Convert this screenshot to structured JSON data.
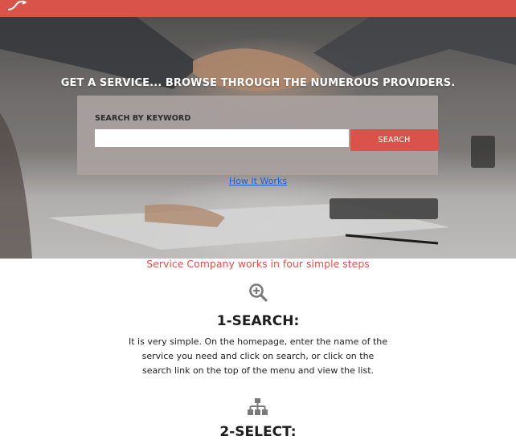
{
  "header": {
    "logo_icon": "logo-icon",
    "brand_color": "#d9534a"
  },
  "hero": {
    "heading": "GET A SERVICE... BROWSE THROUGH THE NUMEROUS PROVIDERS.",
    "search_label": "SEARCH BY KEYWORD",
    "search_value": "",
    "search_placeholder": "",
    "search_button": "SEARCH",
    "how_it_works_link": "How It Works"
  },
  "steps": {
    "intro": "Service Company works in four simple steps",
    "items": [
      {
        "icon": "search-plus-icon",
        "title": "1-SEARCH:",
        "text": "It is very simple. On the homepage, enter the name of the service you need and click on search, or click on the search link on the top of the menu and view the list."
      },
      {
        "icon": "sitemap-icon",
        "title": "2-SELECT:"
      }
    ]
  },
  "colors": {
    "accent": "#d9534a",
    "link": "#1a5fe0",
    "icon": "#7a7a7a"
  }
}
